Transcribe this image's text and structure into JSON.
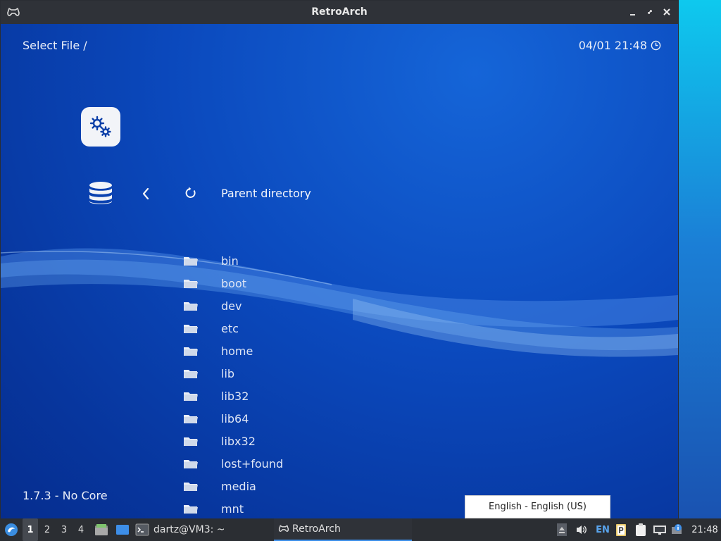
{
  "window": {
    "title": "RetroArch"
  },
  "header": {
    "location": "Select File /",
    "datetime": "04/01 21:48"
  },
  "menu": {
    "parent_label": "Parent directory",
    "items": [
      {
        "label": "bin"
      },
      {
        "label": "boot"
      },
      {
        "label": "dev"
      },
      {
        "label": "etc"
      },
      {
        "label": "home"
      },
      {
        "label": "lib"
      },
      {
        "label": "lib32"
      },
      {
        "label": "lib64"
      },
      {
        "label": "libx32"
      },
      {
        "label": "lost+found"
      },
      {
        "label": "media"
      },
      {
        "label": "mnt"
      }
    ]
  },
  "footer": {
    "version": "1.7.3 - No Core"
  },
  "tooltip": {
    "text": "English - English (US)"
  },
  "taskbar": {
    "workspaces": [
      "1",
      "2",
      "3",
      "4"
    ],
    "terminal_label": "dartz@VM3: ~",
    "active_task_label": "RetroArch",
    "keyboard_layout": "EN",
    "clock": "21:48"
  },
  "colors": {
    "background_blue": "#0b49bd",
    "titlebar": "#2f3238",
    "taskbar": "#2b2e33",
    "accent": "#3d8ee8"
  }
}
